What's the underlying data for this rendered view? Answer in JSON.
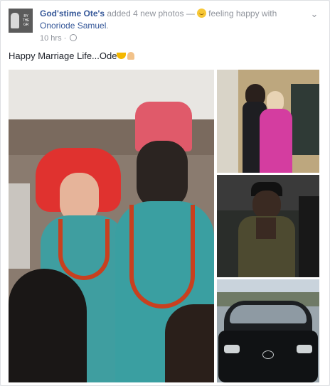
{
  "post": {
    "author": "God'stime Ote's",
    "action": "added 4 new photos —",
    "feeling": "feeling happy with",
    "tagged": "Onoriode Samuel",
    "period": ".",
    "time": "10 hrs",
    "separator": "·",
    "text": "Happy Marriage Life...Ode"
  },
  "icons": {
    "menu": "chevron-down-icon",
    "privacy": "globe-icon",
    "feeling": "smiley-icon"
  },
  "colors": {
    "link": "#365899",
    "meta": "#90949c",
    "text": "#1d2129"
  }
}
